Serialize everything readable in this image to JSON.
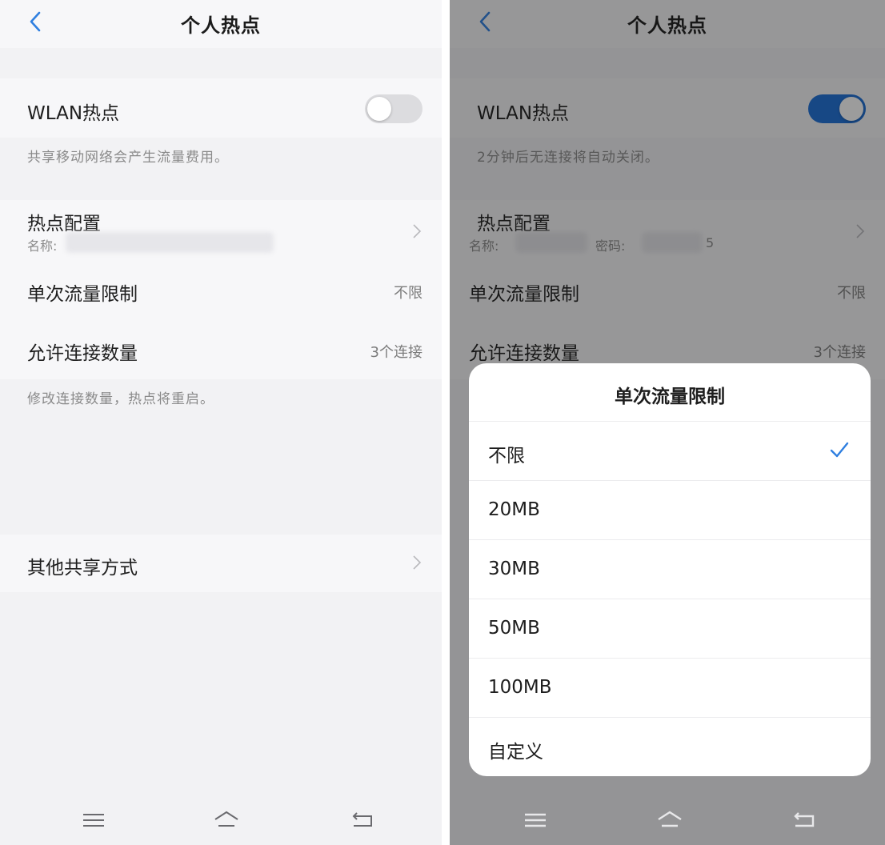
{
  "left": {
    "title": "个人热点",
    "wlan_label": "WLAN热点",
    "wlan_note": "共享移动网络会产生流量费用。",
    "hotspot_config_label": "热点配置",
    "hotspot_config_sub": "名称:",
    "data_limit_label": "单次流量限制",
    "data_limit_value": "不限",
    "connections_label": "允许连接数量",
    "connections_value": "3个连接",
    "connections_note": "修改连接数量，热点将重启。",
    "other_share_label": "其他共享方式"
  },
  "right": {
    "title": "个人热点",
    "wlan_label": "WLAN热点",
    "wlan_note": "2分钟后无连接将自动关闭。",
    "hotspot_config_label": "热点配置",
    "hotspot_config_sub_name": "名称:",
    "hotspot_config_sub_password": "密码:",
    "hotspot_config_sub_tail": "5",
    "data_limit_label": "单次流量限制",
    "data_limit_value": "不限",
    "connections_label": "允许连接数量",
    "connections_value": "3个连接"
  },
  "dialog": {
    "title": "单次流量限制",
    "options": [
      "不限",
      "20MB",
      "30MB",
      "50MB",
      "100MB",
      "自定义"
    ],
    "selected_index": 0
  },
  "colors": {
    "accent": "#1a6ed8",
    "back_arrow": "#2f7fe0"
  },
  "icons": {
    "back": "back-icon",
    "chevron": "chevron-right-icon",
    "check": "check-icon",
    "nav_menu": "menu-icon",
    "nav_home": "home-icon",
    "nav_back": "back-nav-icon"
  },
  "toggles": {
    "left_wlan": false,
    "right_wlan": true
  }
}
